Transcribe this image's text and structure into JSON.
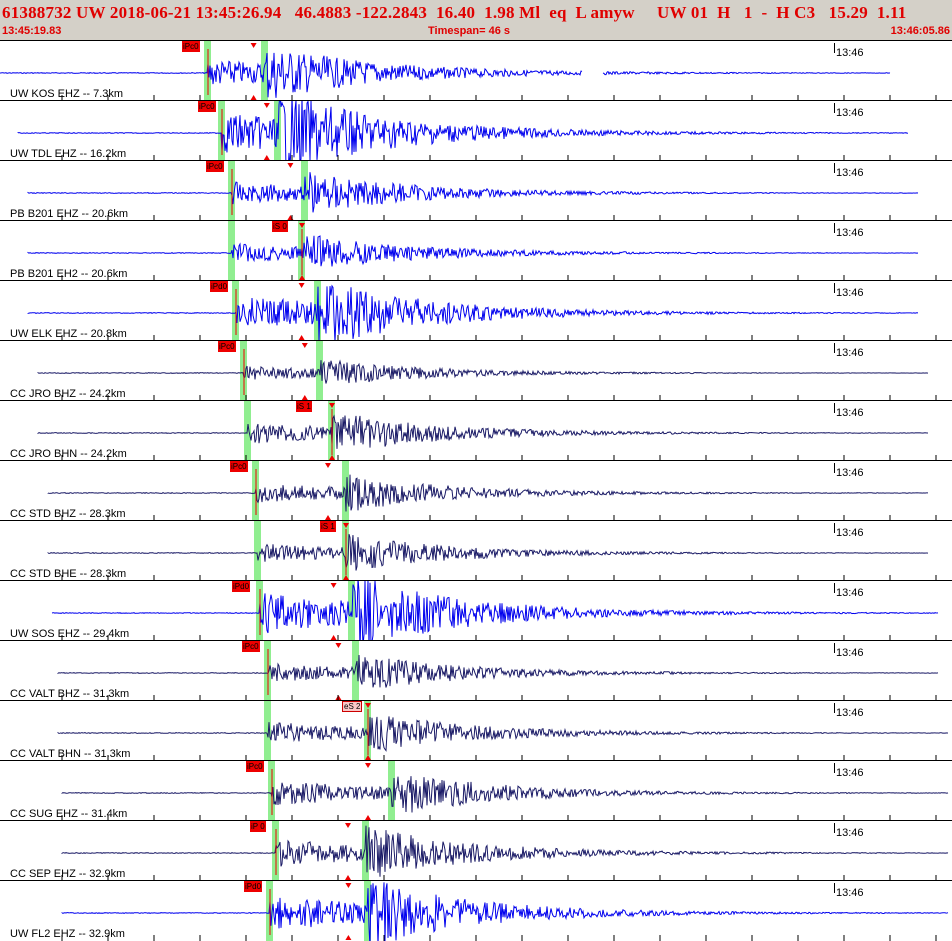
{
  "header": {
    "title": "61388732 UW 2018-06-21 13:45:26.94   46.4883 -122.2843  16.40  1.98 Ml  eq  L amyw     UW 01  H   1  -  H C3   15.29  1.11",
    "start_time": "13:45:19.83",
    "timespan": "Timespan=  46 s",
    "end_time": "13:46:05.86"
  },
  "colors": {
    "header_bg": "#d4d0c8",
    "header_text": "#e00000",
    "trace_uw": "#0000ee",
    "trace_cc": "#1a1a66",
    "pick": "#ee0000",
    "green_band": "#90ee90"
  },
  "panels": [
    {
      "label": "UW KOS EHZ -- 7.3km",
      "time_mark": "13:46",
      "picks": [
        "iPc0"
      ],
      "network": "UW"
    },
    {
      "label": "UW TDL EHZ -- 16.2km",
      "time_mark": "13:46",
      "picks": [
        "iPc0"
      ],
      "network": "UW"
    },
    {
      "label": "PB B201 EHZ -- 20.6km",
      "time_mark": "13:46",
      "picks": [
        "iPc0"
      ],
      "network": "PB"
    },
    {
      "label": "PB B201 EH2 -- 20.6km",
      "time_mark": "13:46",
      "picks": [
        "iS 0"
      ],
      "network": "PB"
    },
    {
      "label": "UW ELK EHZ -- 20.8km",
      "time_mark": "13:46",
      "picks": [
        "iPd0"
      ],
      "network": "UW"
    },
    {
      "label": "CC JRO BHZ -- 24.2km",
      "time_mark": "13:46",
      "picks": [
        "iPc0"
      ],
      "network": "CC"
    },
    {
      "label": "CC JRO BHN -- 24.2km",
      "time_mark": "13:46",
      "picks": [
        "iS 1"
      ],
      "network": "CC"
    },
    {
      "label": "CC STD BHZ -- 28.3km",
      "time_mark": "13:46",
      "picks": [
        "iPc0"
      ],
      "network": "CC"
    },
    {
      "label": "CC STD BHE -- 28.3km",
      "time_mark": "13:46",
      "picks": [
        "iS 1"
      ],
      "network": "CC"
    },
    {
      "label": "UW SOS EHZ -- 29.4km",
      "time_mark": "13:46",
      "picks": [
        "iPd0"
      ],
      "network": "UW"
    },
    {
      "label": "CC VALT BHZ -- 31.3km",
      "time_mark": "13:46",
      "picks": [
        "iPc0"
      ],
      "network": "CC"
    },
    {
      "label": "CC VALT BHN -- 31.3km",
      "time_mark": "13:46",
      "picks": [
        "eS 2"
      ],
      "network": "CC"
    },
    {
      "label": "CC SUG EHZ -- 31.4km",
      "time_mark": "13:46",
      "picks": [
        "iPc0"
      ],
      "network": "CC"
    },
    {
      "label": "CC SEP EHZ -- 32.9km",
      "time_mark": "13:46",
      "picks": [
        "iP 0"
      ],
      "network": "CC"
    },
    {
      "label": "UW FL2 EHZ -- 32.9km",
      "time_mark": "13:46",
      "picks": [
        "iPd0"
      ],
      "network": "UW"
    }
  ]
}
